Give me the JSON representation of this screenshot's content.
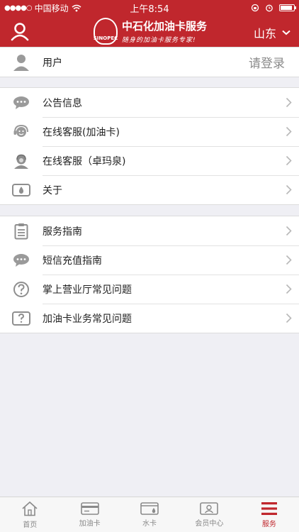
{
  "status_bar": {
    "signal": "●●●●○",
    "carrier": "中国移动",
    "time": "上午8:54"
  },
  "header": {
    "brand_title": "中石化加油卡服务",
    "brand_slogan": "随身的加油卡服务专家!",
    "logo_text": "SINOPEC",
    "region": "山东"
  },
  "user_section": {
    "label": "用户",
    "login_hint": "请登录"
  },
  "section1": {
    "items": [
      {
        "label": "公告信息",
        "icon": "chat-bubble-icon"
      },
      {
        "label": "在线客服(加油卡)",
        "icon": "headset-icon"
      },
      {
        "label": "在线客服（卓玛泉)",
        "icon": "agent-icon"
      },
      {
        "label": "关于",
        "icon": "about-icon"
      }
    ]
  },
  "section2": {
    "items": [
      {
        "label": "服务指南",
        "icon": "clipboard-icon"
      },
      {
        "label": "短信充值指南",
        "icon": "sms-icon"
      },
      {
        "label": "掌上营业厅常见问题",
        "icon": "question-circle-icon"
      },
      {
        "label": "加油卡业务常见问题",
        "icon": "question-square-icon"
      }
    ]
  },
  "tabbar": {
    "tabs": [
      {
        "label": "首页",
        "icon": "home-icon"
      },
      {
        "label": "加油卡",
        "icon": "fuel-card-icon"
      },
      {
        "label": "水卡",
        "icon": "water-card-icon"
      },
      {
        "label": "会员中心",
        "icon": "member-card-icon"
      },
      {
        "label": "服务",
        "icon": "menu-icon"
      }
    ],
    "active": "服务"
  },
  "colors": {
    "brand": "#c0272d",
    "icon_gray": "#8e8e8e",
    "background": "#efeff4"
  }
}
